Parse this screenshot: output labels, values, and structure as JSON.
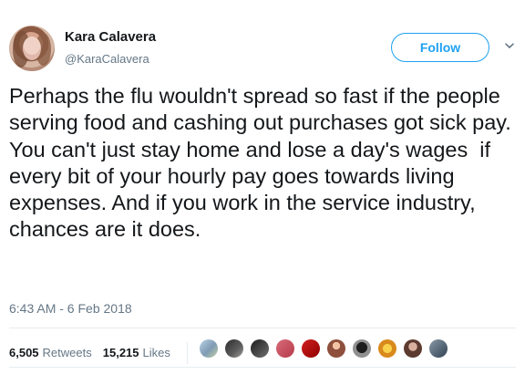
{
  "user": {
    "display_name": "Kara Calavera",
    "handle": "@KaraCalavera"
  },
  "actions": {
    "follow_label": "Follow",
    "more_icon": "chevron-down-icon"
  },
  "tweet": {
    "text": "Perhaps the flu wouldn't spread so fast if the people serving food and cashing out purchases got sick pay. You can't just stay home and lose a day's wages  if every bit of your hourly pay goes towards living expenses. And if you work in the service industry, chances are it does.",
    "timestamp": "6:43 AM - 6 Feb 2018"
  },
  "stats": {
    "retweets_value": "6,505",
    "retweets_label": "Retweets",
    "likes_value": "15,215",
    "likes_label": "Likes"
  },
  "likers": [
    "liker-avatar",
    "liker-avatar",
    "liker-avatar",
    "liker-avatar",
    "liker-avatar",
    "liker-avatar",
    "liker-avatar",
    "liker-avatar",
    "liker-avatar",
    "liker-avatar"
  ],
  "colors": {
    "accent": "#1da1f2",
    "text": "#14171a",
    "muted": "#657786",
    "divider": "#e6ecf0"
  }
}
